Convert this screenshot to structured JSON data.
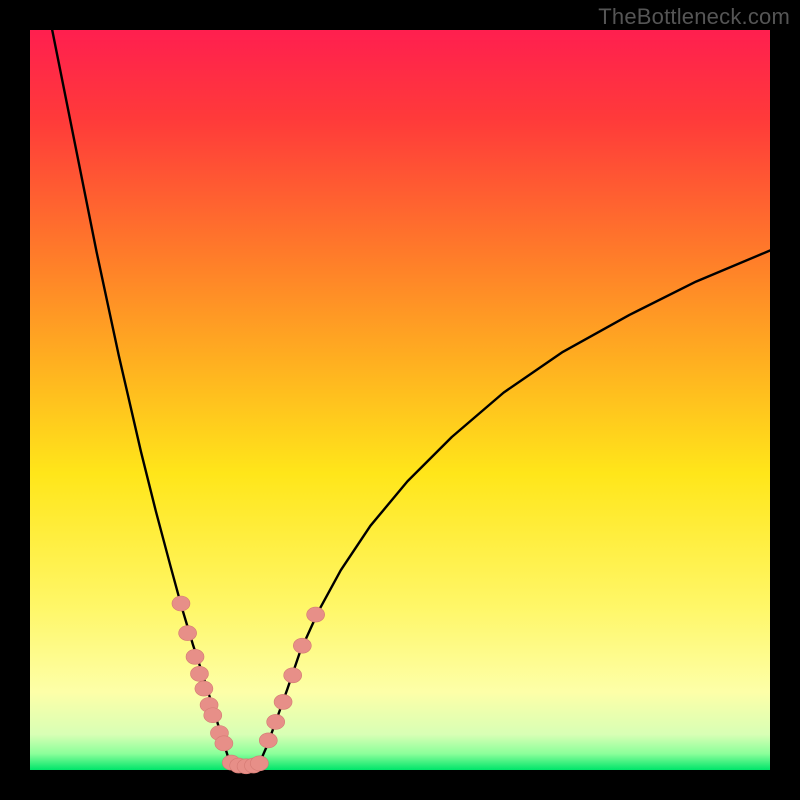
{
  "watermark": "TheBottleneck.com",
  "colors": {
    "frame": "#000000",
    "curve": "#000000",
    "marker_fill": "#e78f88",
    "marker_stroke": "#d47a73",
    "gradient_stops": [
      {
        "offset": 0.0,
        "color": "#ff1f4f"
      },
      {
        "offset": 0.12,
        "color": "#ff3a3a"
      },
      {
        "offset": 0.3,
        "color": "#ff7a2a"
      },
      {
        "offset": 0.45,
        "color": "#ffb020"
      },
      {
        "offset": 0.6,
        "color": "#ffe61a"
      },
      {
        "offset": 0.78,
        "color": "#fff768"
      },
      {
        "offset": 0.895,
        "color": "#fdffa8"
      },
      {
        "offset": 0.952,
        "color": "#d8ffb5"
      },
      {
        "offset": 0.978,
        "color": "#8bff9a"
      },
      {
        "offset": 1.0,
        "color": "#00e56a"
      }
    ]
  },
  "chart_data": {
    "type": "line",
    "title": "",
    "xlabel": "",
    "ylabel": "",
    "xlim": [
      0,
      100
    ],
    "ylim": [
      0,
      100
    ],
    "series": [
      {
        "name": "left-curve",
        "x": [
          3.0,
          6.0,
          9.0,
          12.0,
          15.0,
          17.0,
          19.0,
          20.5,
          22.0,
          23.3,
          24.4,
          25.3,
          26.0,
          26.6,
          27.0
        ],
        "y": [
          100.0,
          85.0,
          70.0,
          56.0,
          43.0,
          35.0,
          27.5,
          22.0,
          17.0,
          13.0,
          9.5,
          6.5,
          4.2,
          2.3,
          0.9
        ]
      },
      {
        "name": "valley-floor",
        "x": [
          27.0,
          27.8,
          28.6,
          29.4,
          30.2,
          31.0
        ],
        "y": [
          0.9,
          0.6,
          0.5,
          0.5,
          0.6,
          0.9
        ]
      },
      {
        "name": "right-curve",
        "x": [
          31.0,
          32.0,
          33.2,
          34.8,
          36.5,
          39.0,
          42.0,
          46.0,
          51.0,
          57.0,
          64.0,
          72.0,
          81.0,
          90.0,
          100.0
        ],
        "y": [
          0.9,
          3.2,
          6.5,
          11.0,
          16.0,
          21.5,
          27.0,
          33.0,
          39.0,
          45.0,
          51.0,
          56.5,
          61.5,
          66.0,
          70.2
        ]
      }
    ],
    "markers": [
      {
        "name": "left-arm-dots",
        "x": [
          20.4,
          21.3,
          22.3,
          22.9,
          23.5,
          24.2,
          24.7,
          25.6,
          26.2
        ],
        "y": [
          22.5,
          18.5,
          15.3,
          13.0,
          11.0,
          8.8,
          7.4,
          5.0,
          3.6
        ]
      },
      {
        "name": "valley-dots",
        "x": [
          27.2,
          28.2,
          29.2,
          30.2,
          31.0
        ],
        "y": [
          1.0,
          0.6,
          0.5,
          0.6,
          0.9
        ]
      },
      {
        "name": "right-arm-dots",
        "x": [
          32.2,
          33.2,
          34.2,
          35.5,
          36.8,
          38.6
        ],
        "y": [
          4.0,
          6.5,
          9.2,
          12.8,
          16.8,
          21.0
        ]
      }
    ]
  }
}
